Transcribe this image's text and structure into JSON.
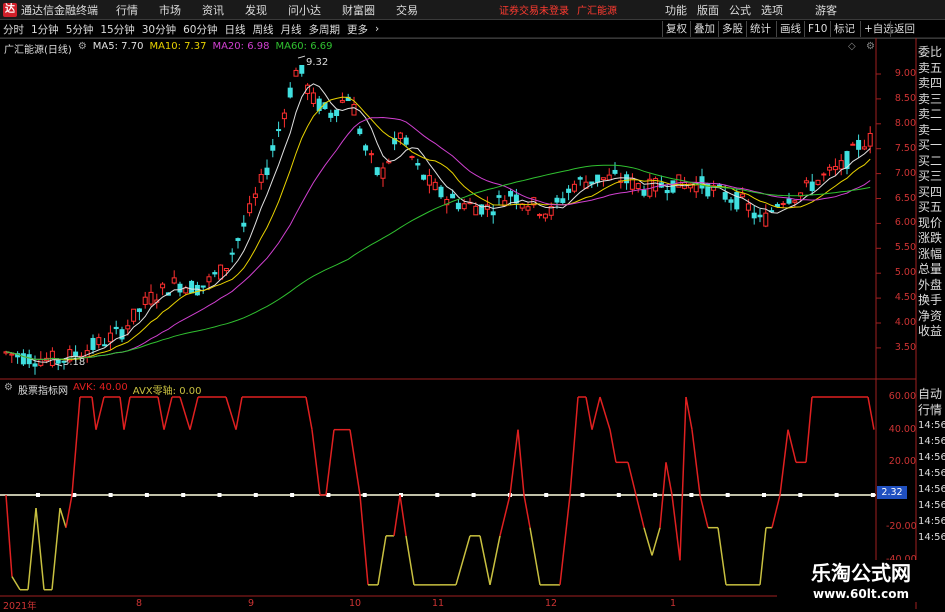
{
  "topbar": {
    "app_name": "通达信金融终端",
    "menu": [
      "行情",
      "市场",
      "资讯",
      "发现",
      "问小达",
      "财富圈",
      "交易"
    ],
    "login_status": "证券交易未登录",
    "stock_name": "广汇能源",
    "right_menu": [
      "功能",
      "版面",
      "公式",
      "选项"
    ],
    "guest": "游客"
  },
  "periods": [
    "分时",
    "1分钟",
    "5分钟",
    "15分钟",
    "30分钟",
    "60分钟",
    "日线",
    "周线",
    "月线",
    "多周期",
    "更多"
  ],
  "toolbar_right": [
    "复权",
    "叠加",
    "多股",
    "统计",
    "画线",
    "F10",
    "标记",
    "+自选",
    "返回"
  ],
  "main_chart": {
    "title": "广汇能源(日线)",
    "ma": [
      {
        "label": "MA5: 7.70",
        "color": "#e0e0e0"
      },
      {
        "label": "MA10: 7.37",
        "color": "#e8d200"
      },
      {
        "label": "MA20: 6.98",
        "color": "#d040d0"
      },
      {
        "label": "MA60: 6.69",
        "color": "#30c030"
      }
    ],
    "high_label": "9.32",
    "low_label": "3.18",
    "y_ticks": [
      "9.00",
      "8.50",
      "8.00",
      "7.50",
      "7.00",
      "6.50",
      "6.00",
      "5.50",
      "5.00",
      "4.50",
      "4.00",
      "3.50"
    ]
  },
  "indicator": {
    "title": "股票指标网",
    "avk": "AVK: 40.00",
    "avx": "AVX零轴: 0.00",
    "y_ticks": [
      "60.00",
      "40.00",
      "20.00",
      "-20.00",
      "-40.00"
    ],
    "current_value": "2.32"
  },
  "x_labels": [
    "2021年",
    "8",
    "9",
    "10",
    "11",
    "12",
    "1"
  ],
  "right_panel": {
    "top": [
      "委比",
      "卖五",
      "卖四",
      "卖三",
      "卖二",
      "卖一",
      "买一",
      "买二",
      "买三",
      "买四",
      "买五",
      "现价",
      "涨跌",
      "涨幅",
      "总量",
      "外盘",
      "换手",
      "净资",
      "收益"
    ],
    "bottom": [
      "自动",
      "行情",
      "14:56",
      "14:56",
      "14:56",
      "14:56",
      "14:56",
      "14:56",
      "14:56",
      "14:56"
    ]
  },
  "watermark": {
    "line1": "乐淘公式网",
    "line2": "www.60lt.com"
  },
  "colors": {
    "up": "#ff3030",
    "down": "#40e0e0",
    "avk": "#e02020",
    "avk_low": "#c8c040",
    "zero": "#ffffe0"
  }
}
